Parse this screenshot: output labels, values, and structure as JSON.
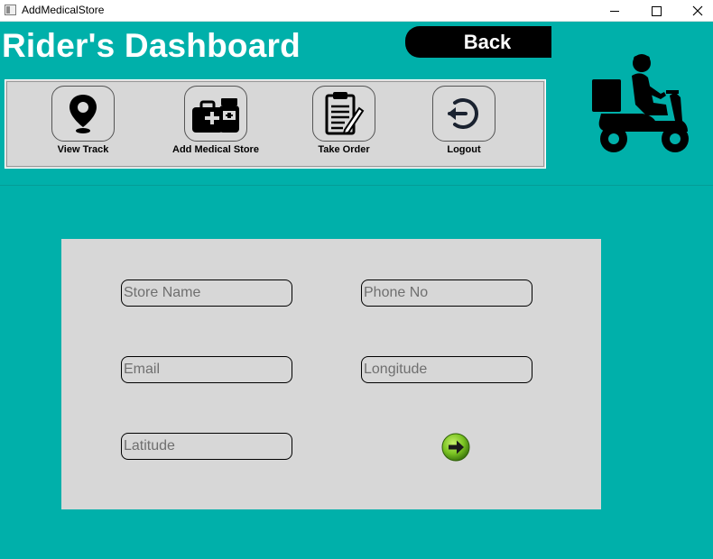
{
  "window": {
    "title": "AddMedicalStore",
    "controls": [
      "minimize-icon",
      "maximize-icon",
      "close-icon"
    ]
  },
  "header": {
    "title": "Rider's Dashboard",
    "back_label": "Back"
  },
  "toolbar": {
    "items": [
      {
        "label": "View Track",
        "icon": "map-pin-icon"
      },
      {
        "label": "Add Medical Store",
        "icon": "medical-kit-icon"
      },
      {
        "label": "Take Order",
        "icon": "clipboard-icon"
      },
      {
        "label": "Logout",
        "icon": "logout-icon"
      }
    ]
  },
  "form": {
    "store_name_placeholder": "Store Name",
    "phone_placeholder": "Phone No",
    "email_placeholder": "Email",
    "longitude_placeholder": "Longitude",
    "latitude_placeholder": "Latitude",
    "submit_icon": "arrow-right-icon"
  },
  "colors": {
    "background": "#00b0aa",
    "panel": "#d7d7d7",
    "back_button": "#000000",
    "submit_green": "#7ac322"
  }
}
